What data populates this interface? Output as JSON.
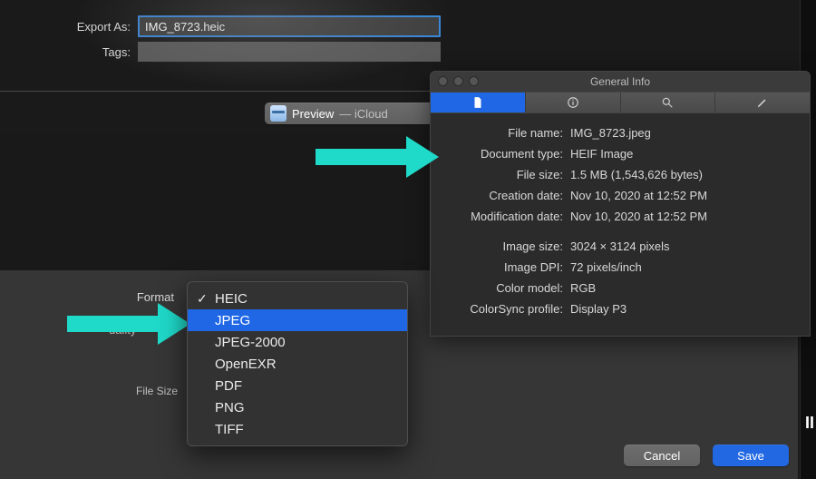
{
  "export": {
    "export_as_label": "Export As:",
    "filename": "IMG_8723.heic",
    "tags_label": "Tags:",
    "location_folder": "Preview",
    "location_suffix": " — iCloud",
    "format_label": "Format",
    "quality_label": "uality",
    "filesize_label": "File Size"
  },
  "format_menu": {
    "items": [
      {
        "label": "HEIC",
        "checked": true,
        "highlight": false
      },
      {
        "label": "JPEG",
        "checked": false,
        "highlight": true
      },
      {
        "label": "JPEG-2000",
        "checked": false,
        "highlight": false
      },
      {
        "label": "OpenEXR",
        "checked": false,
        "highlight": false
      },
      {
        "label": "PDF",
        "checked": false,
        "highlight": false
      },
      {
        "label": "PNG",
        "checked": false,
        "highlight": false
      },
      {
        "label": "TIFF",
        "checked": false,
        "highlight": false
      }
    ]
  },
  "inspector": {
    "title": "General Info",
    "rows": [
      {
        "key": "File name:",
        "val": "IMG_8723.jpeg"
      },
      {
        "key": "Document type:",
        "val": "HEIF Image"
      },
      {
        "key": "File size:",
        "val": "1.5 MB (1,543,626 bytes)"
      },
      {
        "key": "Creation date:",
        "val": "Nov 10, 2020 at 12:52 PM"
      },
      {
        "key": "Modification date:",
        "val": "Nov 10, 2020 at 12:52 PM"
      }
    ],
    "rows2": [
      {
        "key": "Image size:",
        "val": "3024 × 3124 pixels"
      },
      {
        "key": "Image DPI:",
        "val": "72 pixels/inch"
      },
      {
        "key": "Color model:",
        "val": "RGB"
      },
      {
        "key": "ColorSync profile:",
        "val": "Display P3"
      }
    ]
  },
  "buttons": {
    "cancel": "Cancel",
    "save": "Save"
  },
  "right_edge_text": "II",
  "annotation_color": "#1fd9c9"
}
